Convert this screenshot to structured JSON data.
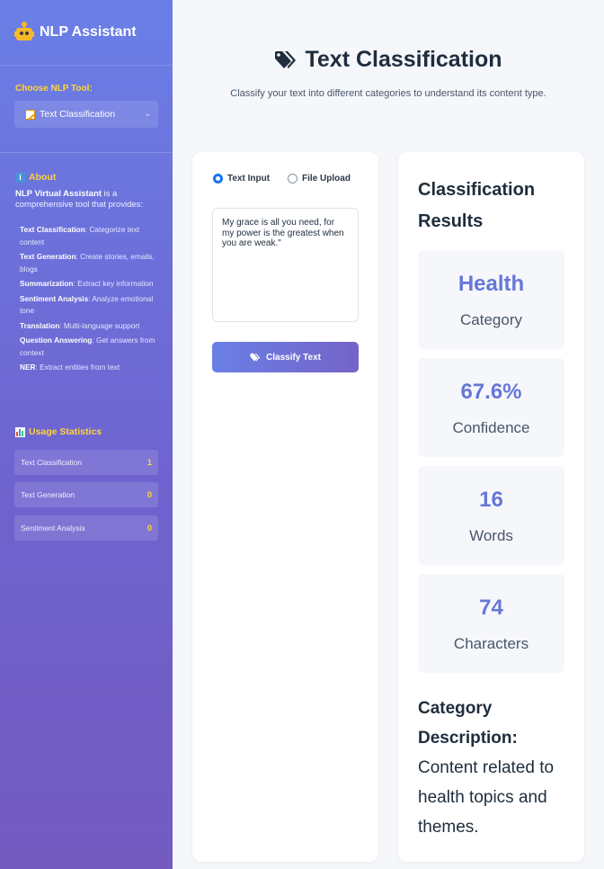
{
  "sidebar": {
    "title": "NLP Assistant",
    "choose_label": "Choose NLP Tool:",
    "selected_tool": "Text Classification",
    "about_title": "About",
    "about_intro_bold": "NLP Virtual Assistant",
    "about_intro_rest": " is a comprehensive tool that provides:",
    "features": [
      {
        "name": "Text Classification",
        "desc": ": Categorize text content"
      },
      {
        "name": "Text Generation",
        "desc": ": Create stories, emails, blogs"
      },
      {
        "name": "Summarization",
        "desc": ": Extract key information"
      },
      {
        "name": "Sentiment Analysis",
        "desc": ": Analyze emotional tone"
      },
      {
        "name": "Translation",
        "desc": ": Multi-language support"
      },
      {
        "name": "Question Answering",
        "desc": ": Get answers from context"
      },
      {
        "name": "NER",
        "desc": ": Extract entities from text"
      }
    ],
    "usage_title": "Usage Statistics",
    "usage": [
      {
        "label": "Text Classification",
        "count": "1"
      },
      {
        "label": "Text Generation",
        "count": "0"
      },
      {
        "label": "Sentiment Analysis",
        "count": "0"
      }
    ]
  },
  "main": {
    "title": "Text Classification",
    "subtitle": "Classify your text into different categories to understand its content type.",
    "input_modes": [
      "Text Input",
      "File Upload"
    ],
    "text_value": "My grace is all you need, for my power is the greatest when you are weak.\"",
    "classify_button": "Classify Text"
  },
  "results": {
    "title": "Classification Results",
    "metrics": [
      {
        "value": "Health",
        "label": "Category"
      },
      {
        "value": "67.6%",
        "label": "Confidence"
      },
      {
        "value": "16",
        "label": "Words"
      },
      {
        "value": "74",
        "label": "Characters"
      }
    ],
    "desc_label": "Category Description:",
    "desc_text": " Content related to health topics and themes."
  },
  "colors": {
    "accent": "#6677d6",
    "highlight": "#ffd33d",
    "radio": "#1a73e8"
  }
}
